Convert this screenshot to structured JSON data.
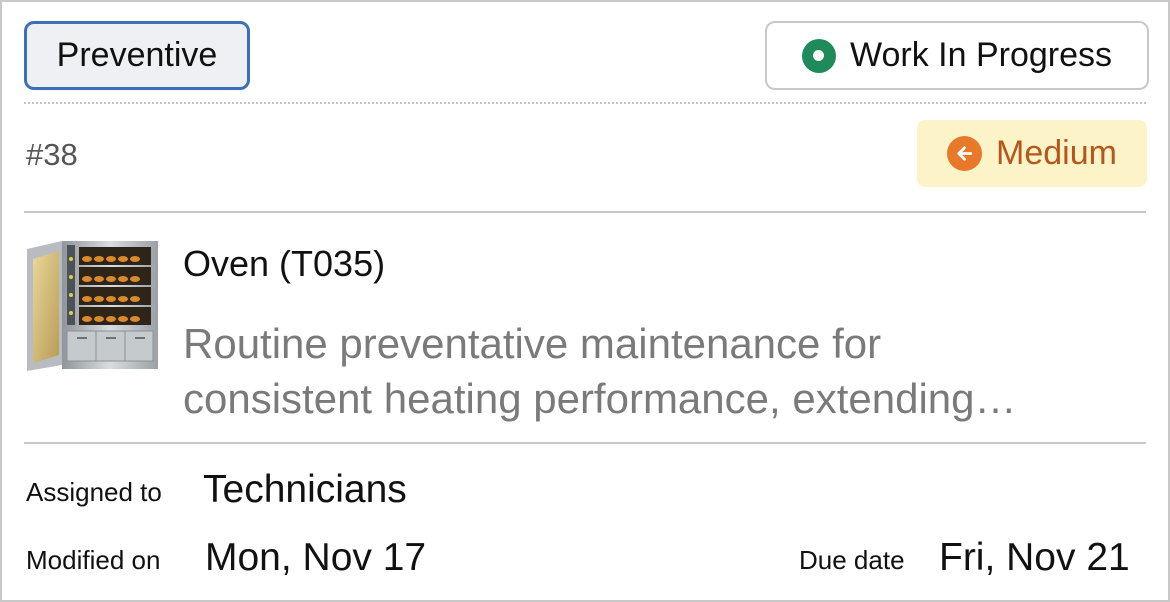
{
  "work_order": {
    "type_label": "Preventive",
    "status_label": "Work In Progress",
    "number": "#38",
    "priority_label": "Medium"
  },
  "asset": {
    "name": "Oven (T035)",
    "description_line1": "Routine preventative maintenance for",
    "description_line2": "consistent heating performance, extending…",
    "thumbnail": "oven-image"
  },
  "meta": {
    "assigned_label": "Assigned to",
    "assigned_value": "Technicians",
    "modified_label": "Modified on",
    "modified_value": "Mon, Nov 17",
    "due_label": "Due date",
    "due_value": "Fri, Nov 21"
  },
  "colors": {
    "type_border": "#3d6fb6",
    "status_dot": "#1f8a5a",
    "priority_bg": "#fdf3c9",
    "priority_icon": "#e8782a",
    "priority_text": "#b5571b",
    "description_text": "#7a7a7a"
  },
  "icons": {
    "status": "status-dot-icon",
    "priority": "arrow-left-circle-icon"
  }
}
